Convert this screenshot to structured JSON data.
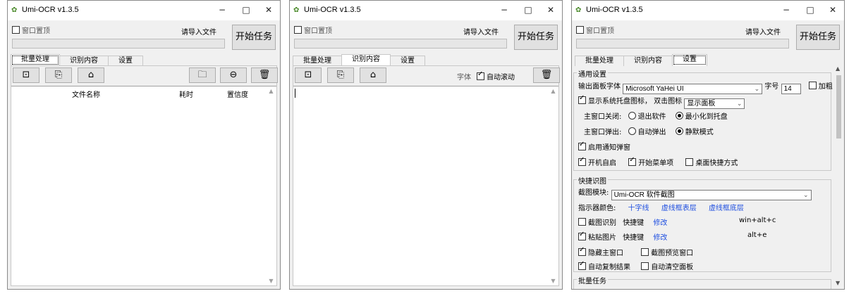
{
  "app_title": "Umi-OCR v1.3.5",
  "titlebar": {
    "minimize": "−",
    "maximize": "□",
    "close": "✕"
  },
  "pin_label": "窗口置顶",
  "import_tip": "请导入文件",
  "start_button": "开始任务",
  "tabs": [
    "批量处理",
    "识别内容",
    "设置"
  ],
  "window1": {
    "columns": [
      "文件名称",
      "耗时",
      "置信度"
    ]
  },
  "window2": {
    "font_label": "字体",
    "auto_scroll_label": "自动滚动"
  },
  "window3": {
    "general": {
      "title": "通用设置",
      "output_font_label": "输出面板字体",
      "output_font_value": "Microsoft YaHei UI",
      "font_size_label": "字号",
      "font_size_value": "14",
      "bold_label": "加粗",
      "tray_icon_label": "显示系统托盘图标， 双击图标",
      "tray_action_value": "显示面板",
      "main_close_label": "主窗口关闭:",
      "main_close_options": [
        "退出软件",
        "最小化到托盘"
      ],
      "main_popup_label": "主窗口弹出:",
      "main_popup_options": [
        "自动弹出",
        "静默模式"
      ],
      "notify_label": "启用通知弹窗",
      "autostart_label": "开机自启",
      "startmenu_label": "开始菜单项",
      "desktop_label": "桌面快捷方式"
    },
    "screenshot": {
      "title": "快捷识图",
      "module_label": "截图模块:",
      "module_value": "Umi-OCR 软件截图",
      "indicator_label": "指示器颜色:",
      "indicator_links": [
        "十字线",
        "虚线框表层",
        "虚线框底层"
      ],
      "capture_label": "截图识别",
      "capture_hotkey_label": "快捷键",
      "capture_modify": "修改",
      "capture_hotkey": "win+alt+c",
      "paste_label": "粘贴图片",
      "paste_hotkey_label": "快捷键",
      "paste_modify": "修改",
      "paste_hotkey": "alt+e",
      "hide_main_label": "隐藏主窗口",
      "preview_label": "截图预览窗口",
      "auto_copy_label": "自动复制结果",
      "auto_clear_label": "自动清空面板"
    },
    "batch_title": "批量任务"
  },
  "icons": {
    "add_image": "⊡",
    "paste": "⎘",
    "capture": "⌂",
    "folder": "🗀",
    "remove": "⊖",
    "trash": "🗑"
  }
}
